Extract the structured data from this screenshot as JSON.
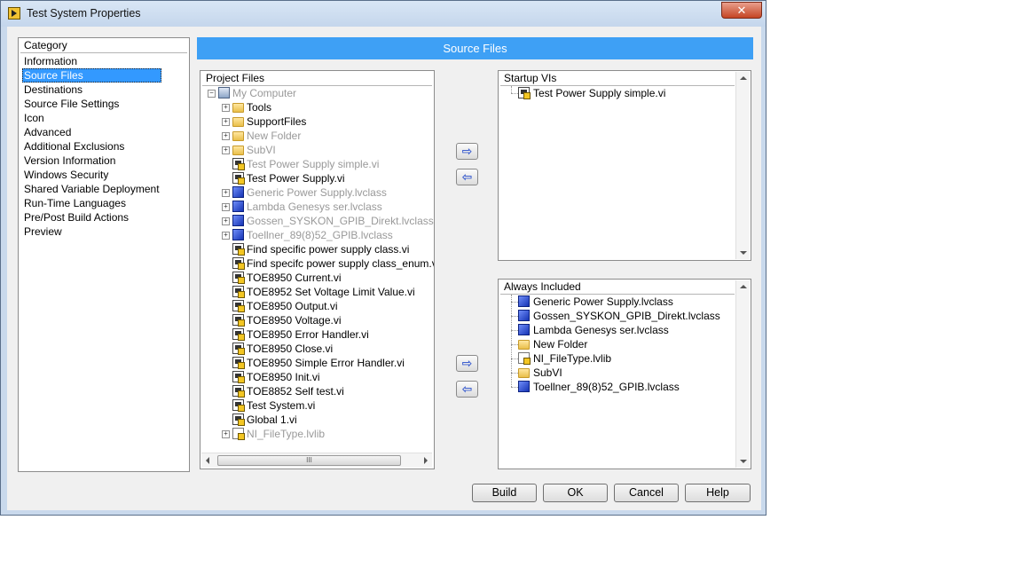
{
  "window": {
    "title": "Test System Properties",
    "close_label": "✕"
  },
  "category": {
    "header": "Category",
    "items": [
      "Information",
      "Source Files",
      "Destinations",
      "Source File Settings",
      "Icon",
      "Advanced",
      "Additional Exclusions",
      "Version Information",
      "Windows Security",
      "Shared Variable Deployment",
      "Run-Time Languages",
      "Pre/Post Build Actions",
      "Preview"
    ],
    "selected": "Source Files"
  },
  "section_title": "Source Files",
  "project_files": {
    "header": "Project Files",
    "items": [
      {
        "label": "My Computer",
        "icon": "computer-icon",
        "gray": true,
        "expander": "minus",
        "indent": 0
      },
      {
        "label": "Tools",
        "icon": "folder-icon",
        "gray": false,
        "expander": "plus",
        "indent": 1
      },
      {
        "label": "SupportFiles",
        "icon": "folder-icon",
        "gray": false,
        "expander": "plus",
        "indent": 1
      },
      {
        "label": "New Folder",
        "icon": "folder-icon",
        "gray": true,
        "expander": "plus",
        "indent": 1
      },
      {
        "label": "SubVI",
        "icon": "folder-icon",
        "gray": true,
        "expander": "plus",
        "indent": 1
      },
      {
        "label": "Test Power Supply simple.vi",
        "icon": "vi-icon",
        "gray": true,
        "expander": "",
        "indent": 1
      },
      {
        "label": "Test Power Supply.vi",
        "icon": "vi-icon",
        "gray": false,
        "expander": "",
        "indent": 1
      },
      {
        "label": "Generic Power Supply.lvclass",
        "icon": "class-icon",
        "gray": true,
        "expander": "plus",
        "indent": 1
      },
      {
        "label": "Lambda Genesys ser.lvclass",
        "icon": "class-icon",
        "gray": true,
        "expander": "plus",
        "indent": 1
      },
      {
        "label": "Gossen_SYSKON_GPIB_Direkt.lvclass",
        "icon": "class-icon",
        "gray": true,
        "expander": "plus",
        "indent": 1
      },
      {
        "label": "Toellner_89(8)52_GPIB.lvclass",
        "icon": "class-icon",
        "gray": true,
        "expander": "plus",
        "indent": 1
      },
      {
        "label": "Find specific power supply class.vi",
        "icon": "vi-icon",
        "gray": false,
        "expander": "",
        "indent": 1
      },
      {
        "label": "Find specifc power supply class_enum.vi",
        "icon": "vi-icon",
        "gray": false,
        "expander": "",
        "indent": 1
      },
      {
        "label": "TOE8950 Current.vi",
        "icon": "vi-icon",
        "gray": false,
        "expander": "",
        "indent": 1
      },
      {
        "label": "TOE8952 Set Voltage Limit Value.vi",
        "icon": "vi-icon",
        "gray": false,
        "expander": "",
        "indent": 1
      },
      {
        "label": "TOE8950 Output.vi",
        "icon": "vi-icon",
        "gray": false,
        "expander": "",
        "indent": 1
      },
      {
        "label": "TOE8950 Voltage.vi",
        "icon": "vi-icon",
        "gray": false,
        "expander": "",
        "indent": 1
      },
      {
        "label": "TOE8950 Error Handler.vi",
        "icon": "vi-icon",
        "gray": false,
        "expander": "",
        "indent": 1
      },
      {
        "label": "TOE8950 Close.vi",
        "icon": "vi-icon",
        "gray": false,
        "expander": "",
        "indent": 1
      },
      {
        "label": "TOE8950 Simple Error Handler.vi",
        "icon": "vi-icon",
        "gray": false,
        "expander": "",
        "indent": 1
      },
      {
        "label": "TOE8950 Init.vi",
        "icon": "vi-icon",
        "gray": false,
        "expander": "",
        "indent": 1
      },
      {
        "label": "TOE8852 Self test.vi",
        "icon": "vi-icon",
        "gray": false,
        "expander": "",
        "indent": 1
      },
      {
        "label": "Test System.vi",
        "icon": "vi-icon",
        "gray": false,
        "expander": "",
        "indent": 1
      },
      {
        "label": "Global 1.vi",
        "icon": "vi-icon",
        "gray": false,
        "expander": "",
        "indent": 1
      },
      {
        "label": "NI_FileType.lvlib",
        "icon": "library-icon",
        "gray": true,
        "expander": "plus",
        "indent": 1
      }
    ],
    "scroll_thumb_label": "III"
  },
  "startup_vis": {
    "header": "Startup VIs",
    "items": [
      {
        "label": "Test Power Supply simple.vi",
        "icon": "vi-icon"
      }
    ]
  },
  "always_included": {
    "header": "Always Included",
    "items": [
      {
        "label": "Generic Power Supply.lvclass",
        "icon": "class-icon"
      },
      {
        "label": "Gossen_SYSKON_GPIB_Direkt.lvclass",
        "icon": "class-icon"
      },
      {
        "label": "Lambda Genesys ser.lvclass",
        "icon": "class-icon"
      },
      {
        "label": "New Folder",
        "icon": "folder-icon"
      },
      {
        "label": "NI_FileType.lvlib",
        "icon": "library-icon"
      },
      {
        "label": "SubVI",
        "icon": "folder-icon"
      },
      {
        "label": "Toellner_89(8)52_GPIB.lvclass",
        "icon": "class-icon"
      }
    ]
  },
  "move_buttons": {
    "add_symbol": "⇨",
    "remove_symbol": "⇦"
  },
  "buttons": {
    "build": "Build",
    "ok": "OK",
    "cancel": "Cancel",
    "help": "Help"
  }
}
